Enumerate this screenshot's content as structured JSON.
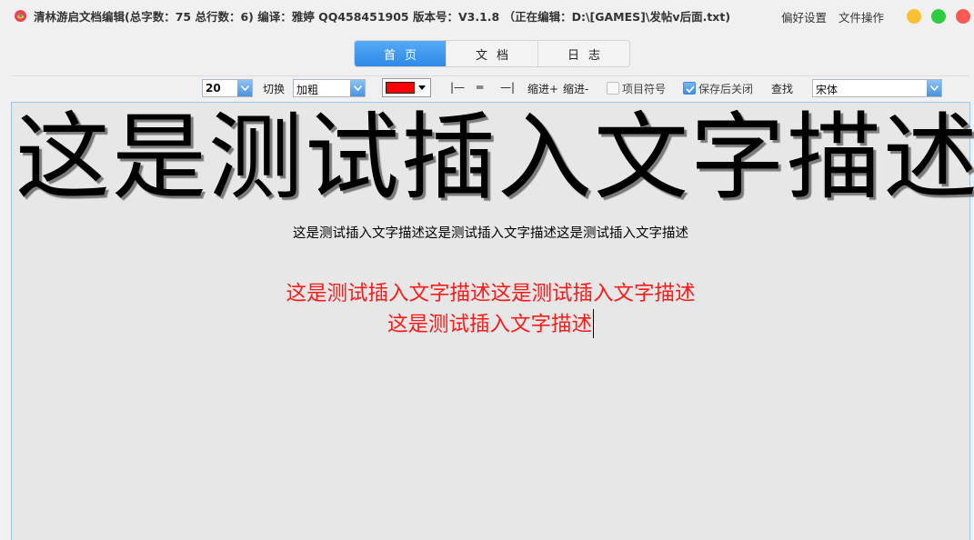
{
  "titlebar": {
    "title": "清林游启文档编辑(总字数：75 总行数：6) 编译：雅婷 QQ458451905 版本号：V3.1.8 （正在编辑：D:\\[GAMES]\\发帖v后面.txt)",
    "menu": [
      "偏好设置",
      "文件操作"
    ],
    "window_buttons": [
      {
        "name": "minimize",
        "color": "#fbc02d"
      },
      {
        "name": "maximize",
        "color": "#2ecc40"
      },
      {
        "name": "close",
        "color": "#ff5a52"
      }
    ]
  },
  "tabs": [
    {
      "label": "首页",
      "active": true
    },
    {
      "label": "文档",
      "active": false
    },
    {
      "label": "日志",
      "active": false
    }
  ],
  "toolbar": {
    "font_size": "20",
    "switch_label": "切换",
    "style_value": "加粗",
    "color": "#ff0000",
    "align_left": "|—",
    "align_center": "═",
    "align_right": "—|",
    "indent_in": "缩进+",
    "indent_out": "缩进-",
    "bullet_label": "项目符号",
    "bullet_checked": false,
    "save_close_label": "保存后关闭",
    "save_close_checked": true,
    "find_label": "查找",
    "font_value": "宋体"
  },
  "editor": {
    "big_line": "这是测试插入文字描述",
    "black_line": "这是测试插入文字描述这是测试插入文字描述这是测试插入文字描述",
    "red_line_1": "这是测试插入文字描述这是测试插入文字描述",
    "red_line_2": "这是测试插入文字描述"
  }
}
